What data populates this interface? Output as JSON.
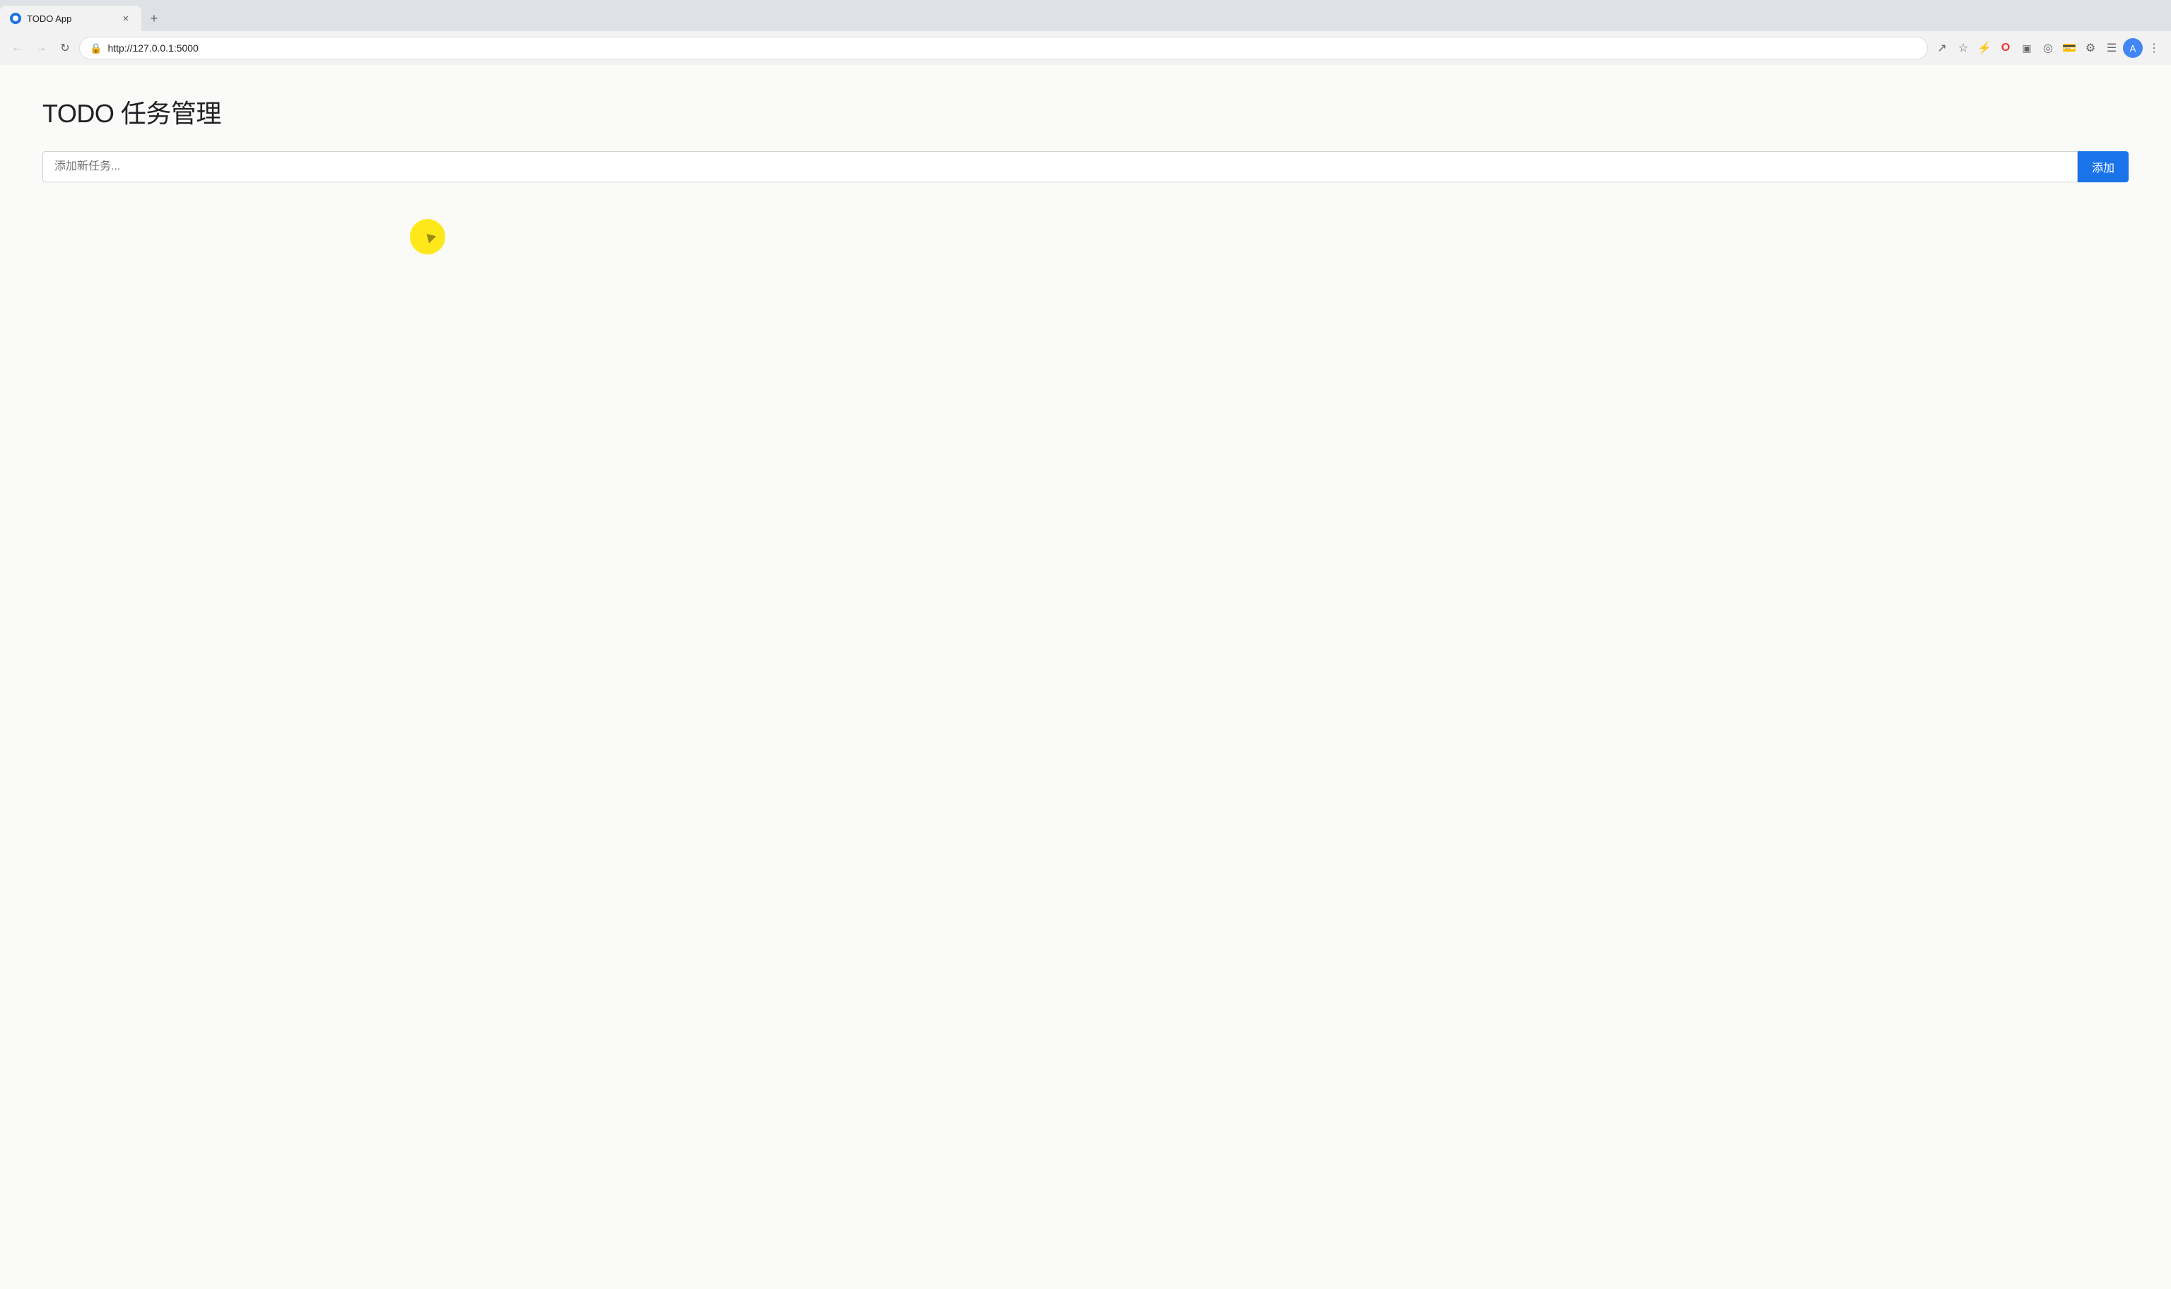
{
  "browser": {
    "tab": {
      "title": "TODO App",
      "favicon_label": "todo-favicon"
    },
    "toolbar": {
      "url": "http://127.0.0.1:5000",
      "back_label": "←",
      "forward_label": "→",
      "refresh_label": "↻",
      "new_tab_label": "+"
    }
  },
  "page": {
    "title": "TODO 任务管理",
    "input_placeholder": "添加新任务...",
    "add_button_label": "添加"
  },
  "cursor": {
    "visible": true
  }
}
